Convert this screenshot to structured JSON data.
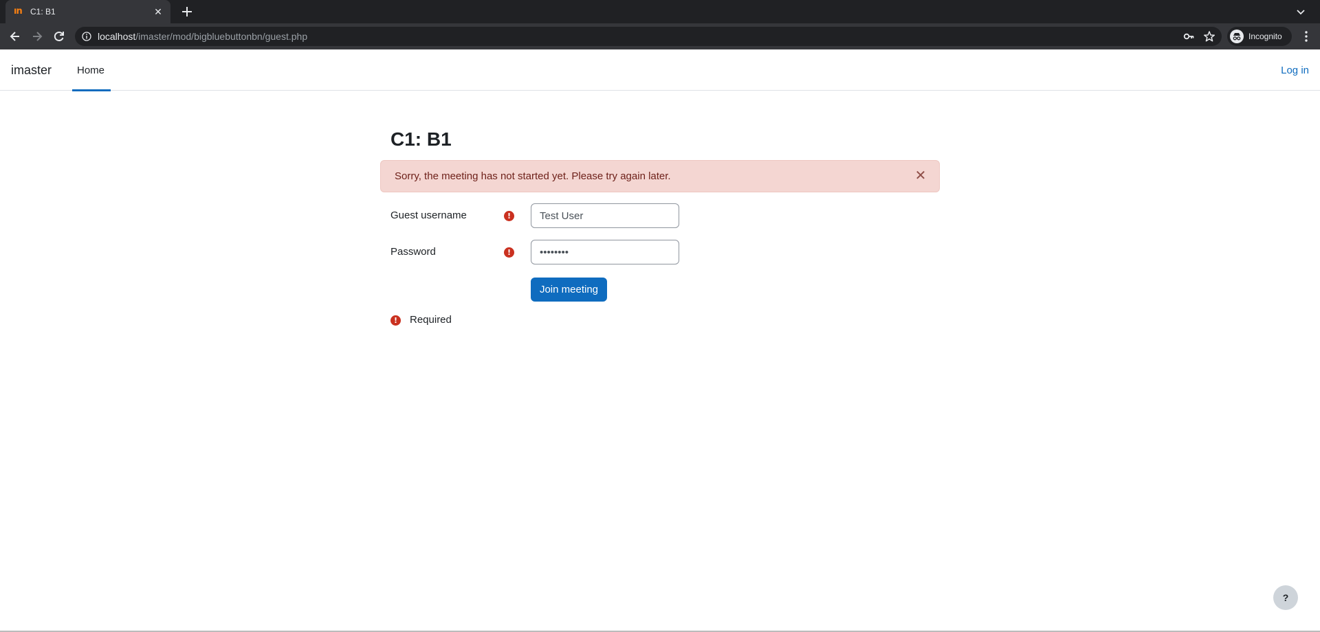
{
  "browser": {
    "tab_title": "C1: B1",
    "tab_favicon": "ın",
    "url_host": "localhost",
    "url_path": "/imaster/mod/bigbluebuttonbn/guest.php",
    "incognito_label": "Incognito"
  },
  "navbar": {
    "brand": "imaster",
    "home_label": "Home",
    "login_label": "Log in"
  },
  "page": {
    "title": "C1: B1",
    "alert_text": "Sorry, the meeting has not started yet. Please try again later.",
    "alert_close": "✕"
  },
  "form": {
    "username_label": "Guest username",
    "username_value": "Test User",
    "password_label": "Password",
    "password_value": "password",
    "required_icon": "!",
    "join_label": "Join meeting",
    "required_note": "Required"
  },
  "help": {
    "label": "?"
  },
  "colors": {
    "primary": "#0f6cbf",
    "danger": "#ca3120",
    "alert_bg": "#f4d6d2",
    "alert_text": "#6e211a"
  }
}
